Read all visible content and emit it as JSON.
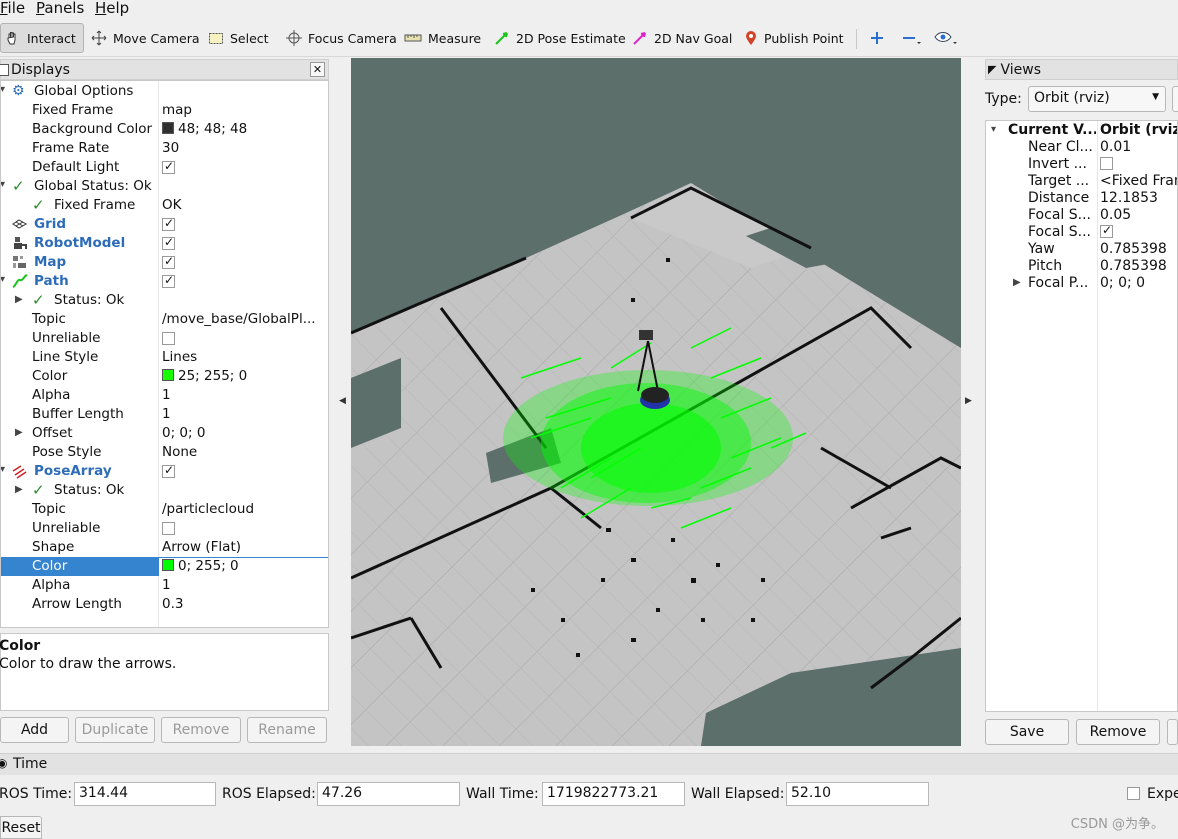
{
  "menu": {
    "file": "File",
    "panels": "Panels",
    "help": "Help"
  },
  "toolbar": {
    "interact": "Interact",
    "move_camera": "Move Camera",
    "select": "Select",
    "focus_camera": "Focus Camera",
    "measure": "Measure",
    "pose_estimate": "2D Pose Estimate",
    "nav_goal": "2D Nav Goal",
    "publish_point": "Publish Point"
  },
  "displays": {
    "title": "Displays",
    "rows": {
      "global_options": "Global Options",
      "fixed_frame": {
        "name": "Fixed Frame",
        "value": "map"
      },
      "background_color": {
        "name": "Background Color",
        "value": "48; 48; 48",
        "swatch": "#303030"
      },
      "frame_rate": {
        "name": "Frame Rate",
        "value": "30"
      },
      "default_light": {
        "name": "Default Light"
      },
      "global_status": "Global Status: Ok",
      "gs_fixed_frame": {
        "name": "Fixed Frame",
        "value": "OK"
      },
      "grid": "Grid",
      "robot_model": "RobotModel",
      "map": "Map",
      "path": "Path",
      "path_status": "Status: Ok",
      "path_topic": {
        "name": "Topic",
        "value": "/move_base/GlobalPl..."
      },
      "path_unreliable": {
        "name": "Unreliable"
      },
      "line_style": {
        "name": "Line Style",
        "value": "Lines"
      },
      "path_color": {
        "name": "Color",
        "value": "25; 255; 0",
        "swatch": "#19ff00"
      },
      "path_alpha": {
        "name": "Alpha",
        "value": "1"
      },
      "buffer_length": {
        "name": "Buffer Length",
        "value": "1"
      },
      "offset": {
        "name": "Offset",
        "value": "0; 0; 0"
      },
      "pose_style": {
        "name": "Pose Style",
        "value": "None"
      },
      "pose_array": "PoseArray",
      "pa_status": "Status: Ok",
      "pa_topic": {
        "name": "Topic",
        "value": "/particlecloud"
      },
      "pa_unreliable": {
        "name": "Unreliable"
      },
      "shape": {
        "name": "Shape",
        "value": "Arrow (Flat)"
      },
      "pa_color": {
        "name": "Color",
        "value": "0; 255; 0",
        "swatch": "#00ff00"
      },
      "pa_alpha": {
        "name": "Alpha",
        "value": "1"
      },
      "arrow_length": {
        "name": "Arrow Length",
        "value": "0.3"
      }
    },
    "description_title": "Color",
    "description_text": "Color to draw the arrows.",
    "buttons": {
      "add": "Add",
      "duplicate": "Duplicate",
      "remove": "Remove",
      "rename": "Rename"
    }
  },
  "views": {
    "title": "Views",
    "type_label": "Type:",
    "type_value": "Orbit (rviz)",
    "rows": [
      {
        "name": "Current V...",
        "value": "Orbit (rviz)"
      },
      {
        "name": "Near Cl...",
        "value": "0.01"
      },
      {
        "name": "Invert ...",
        "value": ""
      },
      {
        "name": "Target ...",
        "value": "<Fixed Frame>"
      },
      {
        "name": "Distance",
        "value": "12.1853"
      },
      {
        "name": "Focal S...",
        "value": "0.05"
      },
      {
        "name": "Focal S...",
        "value": ""
      },
      {
        "name": "Yaw",
        "value": "0.785398"
      },
      {
        "name": "Pitch",
        "value": "0.785398"
      },
      {
        "name": "Focal P...",
        "value": "0; 0; 0"
      }
    ],
    "buttons": {
      "save": "Save",
      "remove": "Remove"
    }
  },
  "time": {
    "title": "Time",
    "ros_time_label": "ROS Time:",
    "ros_time": "314.44",
    "ros_elapsed_label": "ROS Elapsed:",
    "ros_elapsed": "47.26",
    "wall_time_label": "Wall Time:",
    "wall_time": "1719822773.21",
    "wall_elapsed_label": "Wall Elapsed:",
    "wall_elapsed": "52.10",
    "experimental_label": "Expe",
    "reset": "Reset"
  },
  "watermark": "CSDN @为争。",
  "colors": {
    "selection": "#3584d0",
    "map_background": "#5d6f6b",
    "particles": "#00ff00",
    "display_blue": "#2e6cb8"
  }
}
